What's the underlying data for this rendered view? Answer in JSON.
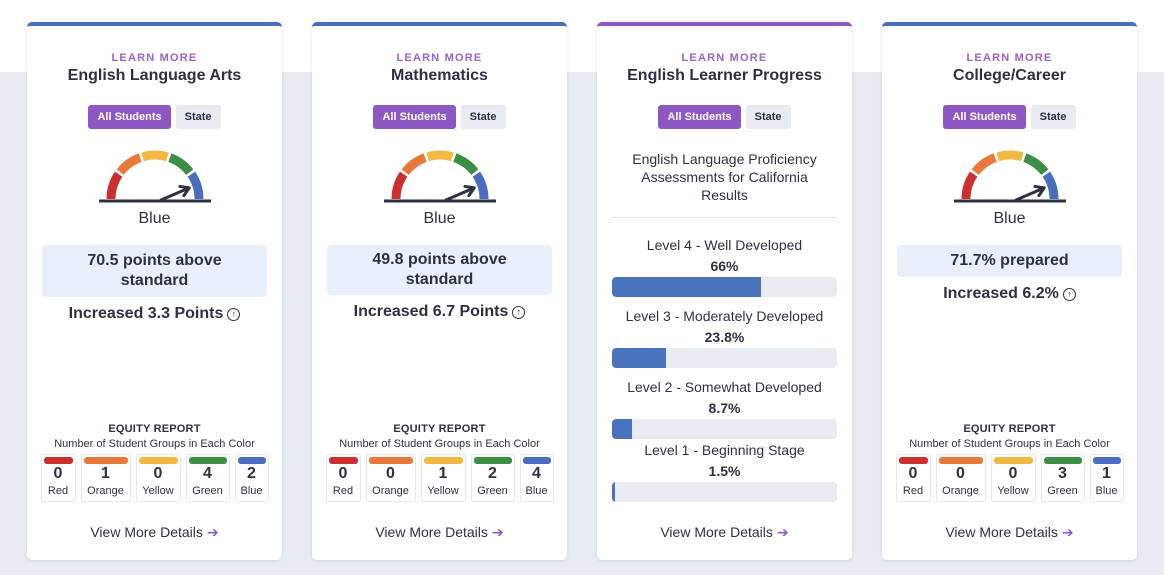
{
  "colors": {
    "red": "#cc2f2f",
    "orange": "#e8793a",
    "yellow": "#f1b944",
    "green": "#3a8f45",
    "blue": "#4a6dc0",
    "purple_accent": "#8d58c4",
    "needle": "#2e3142"
  },
  "cards": [
    {
      "learn_more": "LEARN MORE",
      "title": "English Language Arts",
      "toggle": {
        "active": "All Students",
        "inactive": "State"
      },
      "gauge_level": "blue",
      "color_label": "Blue",
      "status": "70.5 points above standard",
      "change": "Increased 3.3 Points",
      "change_icon": "arrow-up-circle-icon",
      "equity": {
        "title": "EQUITY REPORT",
        "subtitle": "Number of Student Groups in Each Color",
        "items": [
          {
            "label": "Red",
            "count": "0"
          },
          {
            "label": "Orange",
            "count": "1"
          },
          {
            "label": "Yellow",
            "count": "0"
          },
          {
            "label": "Green",
            "count": "4"
          },
          {
            "label": "Blue",
            "count": "2"
          }
        ]
      },
      "details": "View More Details"
    },
    {
      "learn_more": "LEARN MORE",
      "title": "Mathematics",
      "toggle": {
        "active": "All Students",
        "inactive": "State"
      },
      "gauge_level": "blue",
      "color_label": "Blue",
      "status": "49.8 points above standard",
      "change": "Increased 6.7 Points",
      "change_icon": "arrow-up-circle-icon",
      "equity": {
        "title": "EQUITY REPORT",
        "subtitle": "Number of Student Groups in Each Color",
        "items": [
          {
            "label": "Red",
            "count": "0"
          },
          {
            "label": "Orange",
            "count": "0"
          },
          {
            "label": "Yellow",
            "count": "1"
          },
          {
            "label": "Green",
            "count": "2"
          },
          {
            "label": "Blue",
            "count": "4"
          }
        ]
      },
      "details": "View More Details"
    },
    {
      "learn_more": "LEARN MORE",
      "title": "English Learner Progress",
      "toggle": {
        "active": "All Students",
        "inactive": "State"
      },
      "subtitle": "English Language Proficiency Assessments for California Results",
      "levels": [
        {
          "label": "Level 4 - Well Developed",
          "pct_text": "66%",
          "pct": 66
        },
        {
          "label": "Level 3 - Moderately Developed",
          "pct_text": "23.8%",
          "pct": 23.8
        },
        {
          "label": "Level 2 - Somewhat Developed",
          "pct_text": "8.7%",
          "pct": 8.7
        },
        {
          "label": "Level 1 - Beginning Stage",
          "pct_text": "1.5%",
          "pct": 1.5
        }
      ],
      "details": "View More Details"
    },
    {
      "learn_more": "LEARN MORE",
      "title": "College/Career",
      "toggle": {
        "active": "All Students",
        "inactive": "State"
      },
      "gauge_level": "blue",
      "color_label": "Blue",
      "status": "71.7% prepared",
      "change": "Increased 6.2%",
      "change_icon": "arrow-up-circle-icon",
      "equity": {
        "title": "EQUITY REPORT",
        "subtitle": "Number of Student Groups in Each Color",
        "items": [
          {
            "label": "Red",
            "count": "0"
          },
          {
            "label": "Orange",
            "count": "0"
          },
          {
            "label": "Yellow",
            "count": "0"
          },
          {
            "label": "Green",
            "count": "3"
          },
          {
            "label": "Blue",
            "count": "1"
          }
        ]
      },
      "details": "View More Details"
    }
  ],
  "icons": {
    "up": "↑",
    "right_arrow": "➔"
  }
}
